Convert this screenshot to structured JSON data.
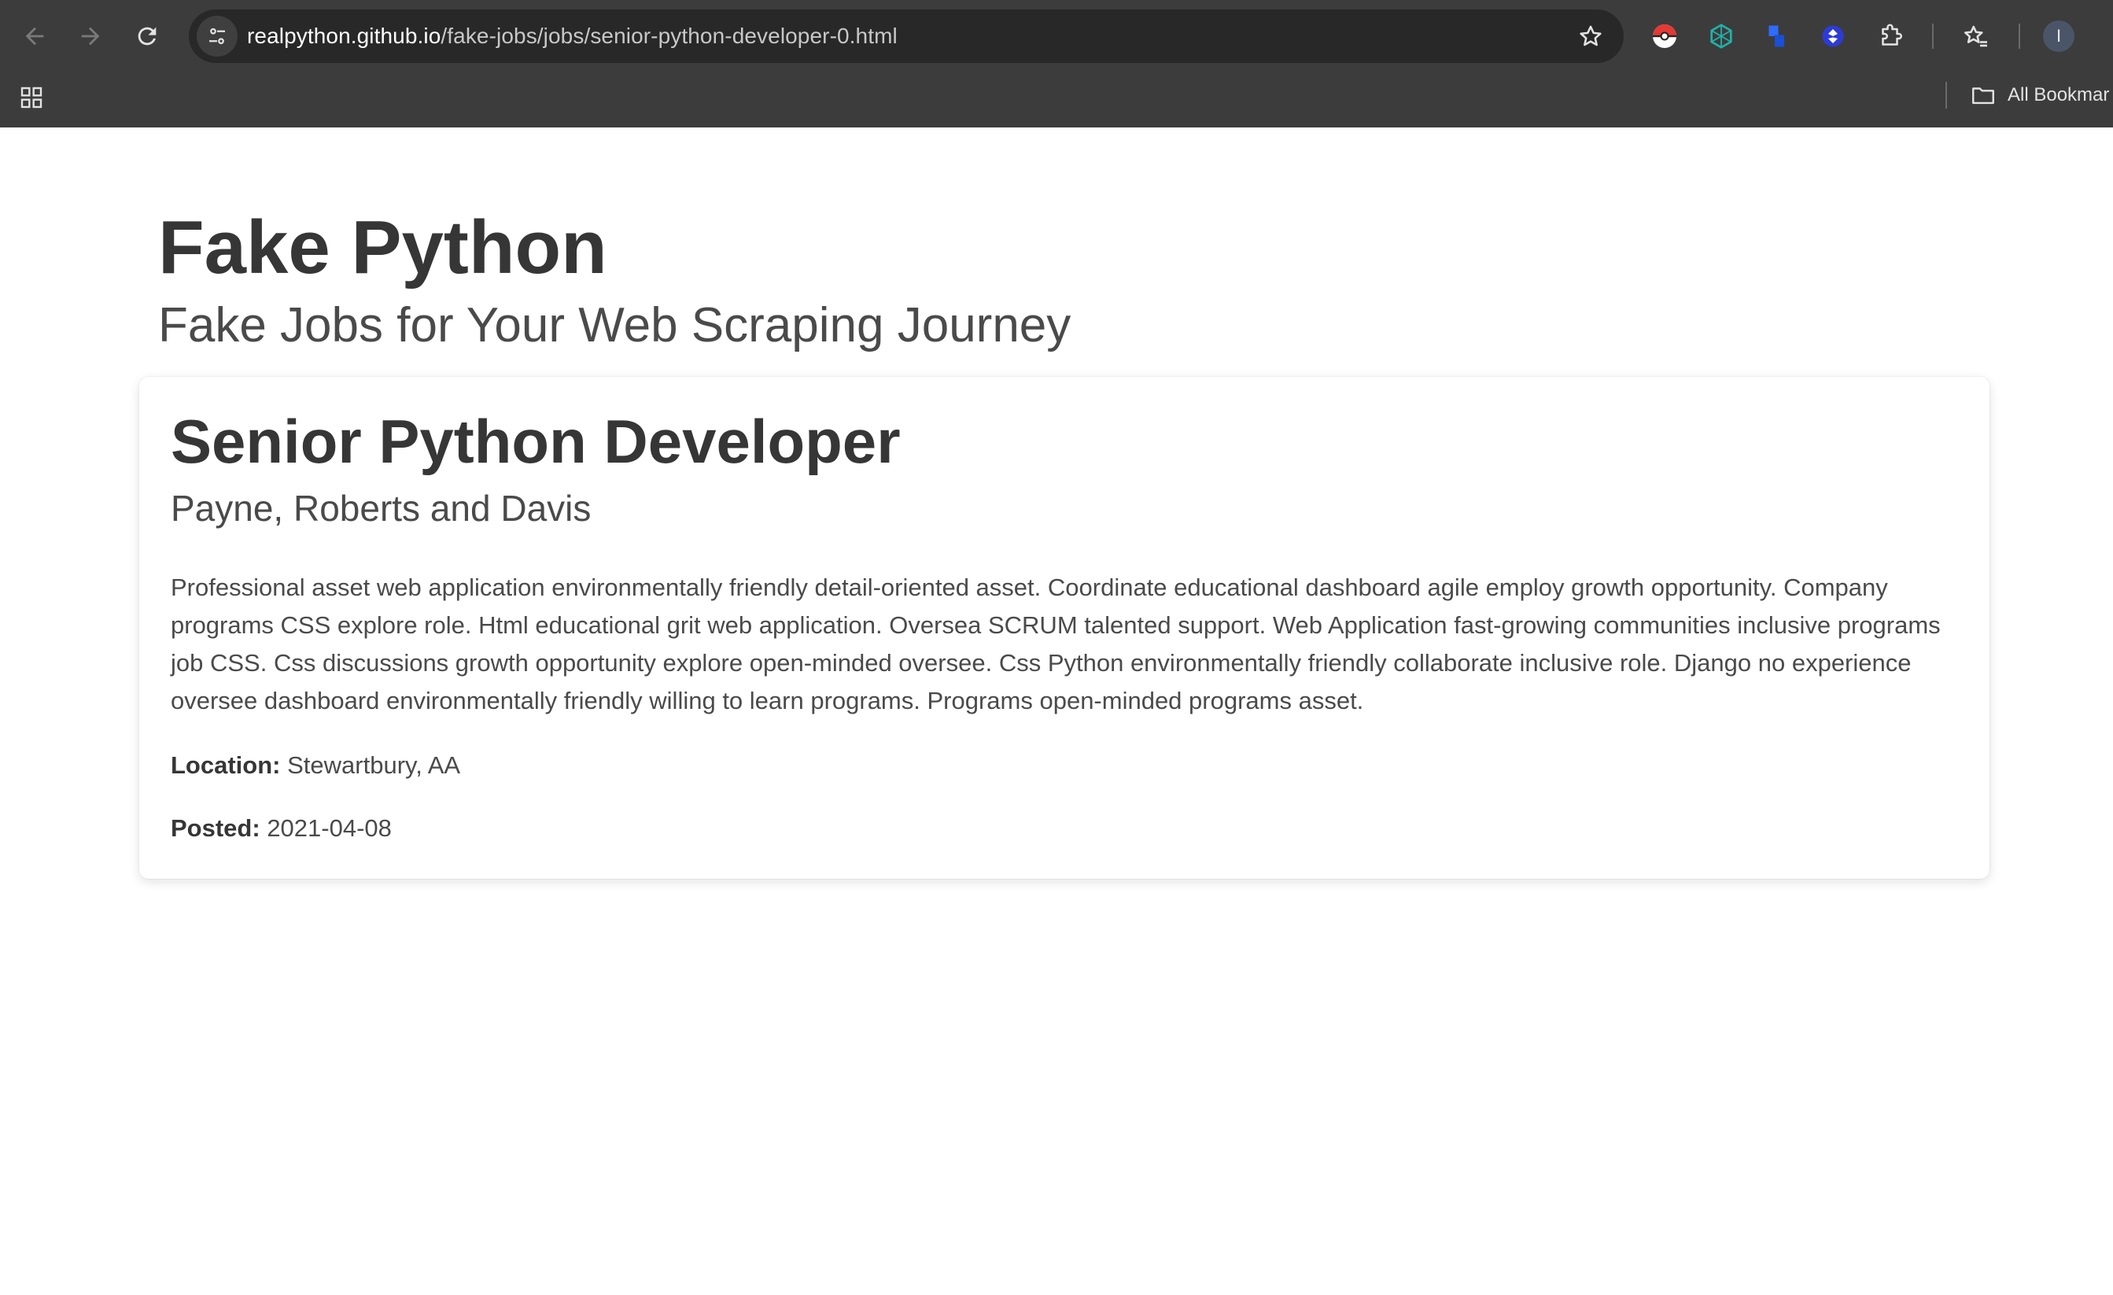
{
  "browser": {
    "url_host": "realpython.github.io",
    "url_path": "/fake-jobs/jobs/senior-python-developer-0.html",
    "profile_initial": "I",
    "bookmarks_label": "All Bookmar",
    "icons": {
      "back": "back-arrow-icon",
      "forward": "forward-arrow-icon",
      "reload": "reload-icon",
      "site_info": "tune-icon",
      "bookmark": "star-outline-icon",
      "extensions": [
        "pokeball-icon",
        "hexagon-network-icon",
        "blue-blocks-icon",
        "blue-diamond-icon",
        "puzzle-icon"
      ],
      "reading_list": "star-list-icon",
      "apps": "apps-grid-icon",
      "bookmarks_folder": "folder-icon"
    }
  },
  "header": {
    "title": "Fake Python",
    "subtitle": "Fake Jobs for Your Web Scraping Journey"
  },
  "job": {
    "title": "Senior Python Developer",
    "company": "Payne, Roberts and Davis",
    "description": "Professional asset web application environmentally friendly detail-oriented asset. Coordinate educational dashboard agile employ growth opportunity. Company programs CSS explore role. Html educational grit web application. Oversea SCRUM talented support. Web Application fast-growing communities inclusive programs job CSS. Css discussions growth opportunity explore open-minded oversee. Css Python environmentally friendly collaborate inclusive role. Django no experience oversee dashboard environmentally friendly willing to learn programs. Programs open-minded programs asset.",
    "location_label": "Location:",
    "location": "Stewartbury, AA",
    "posted_label": "Posted:",
    "posted": "2021-04-08"
  },
  "colors": {
    "chrome_bg": "#3c3c3c",
    "omnibox_bg": "#282828",
    "title_text": "#363636",
    "body_text": "#4a4a4a"
  }
}
